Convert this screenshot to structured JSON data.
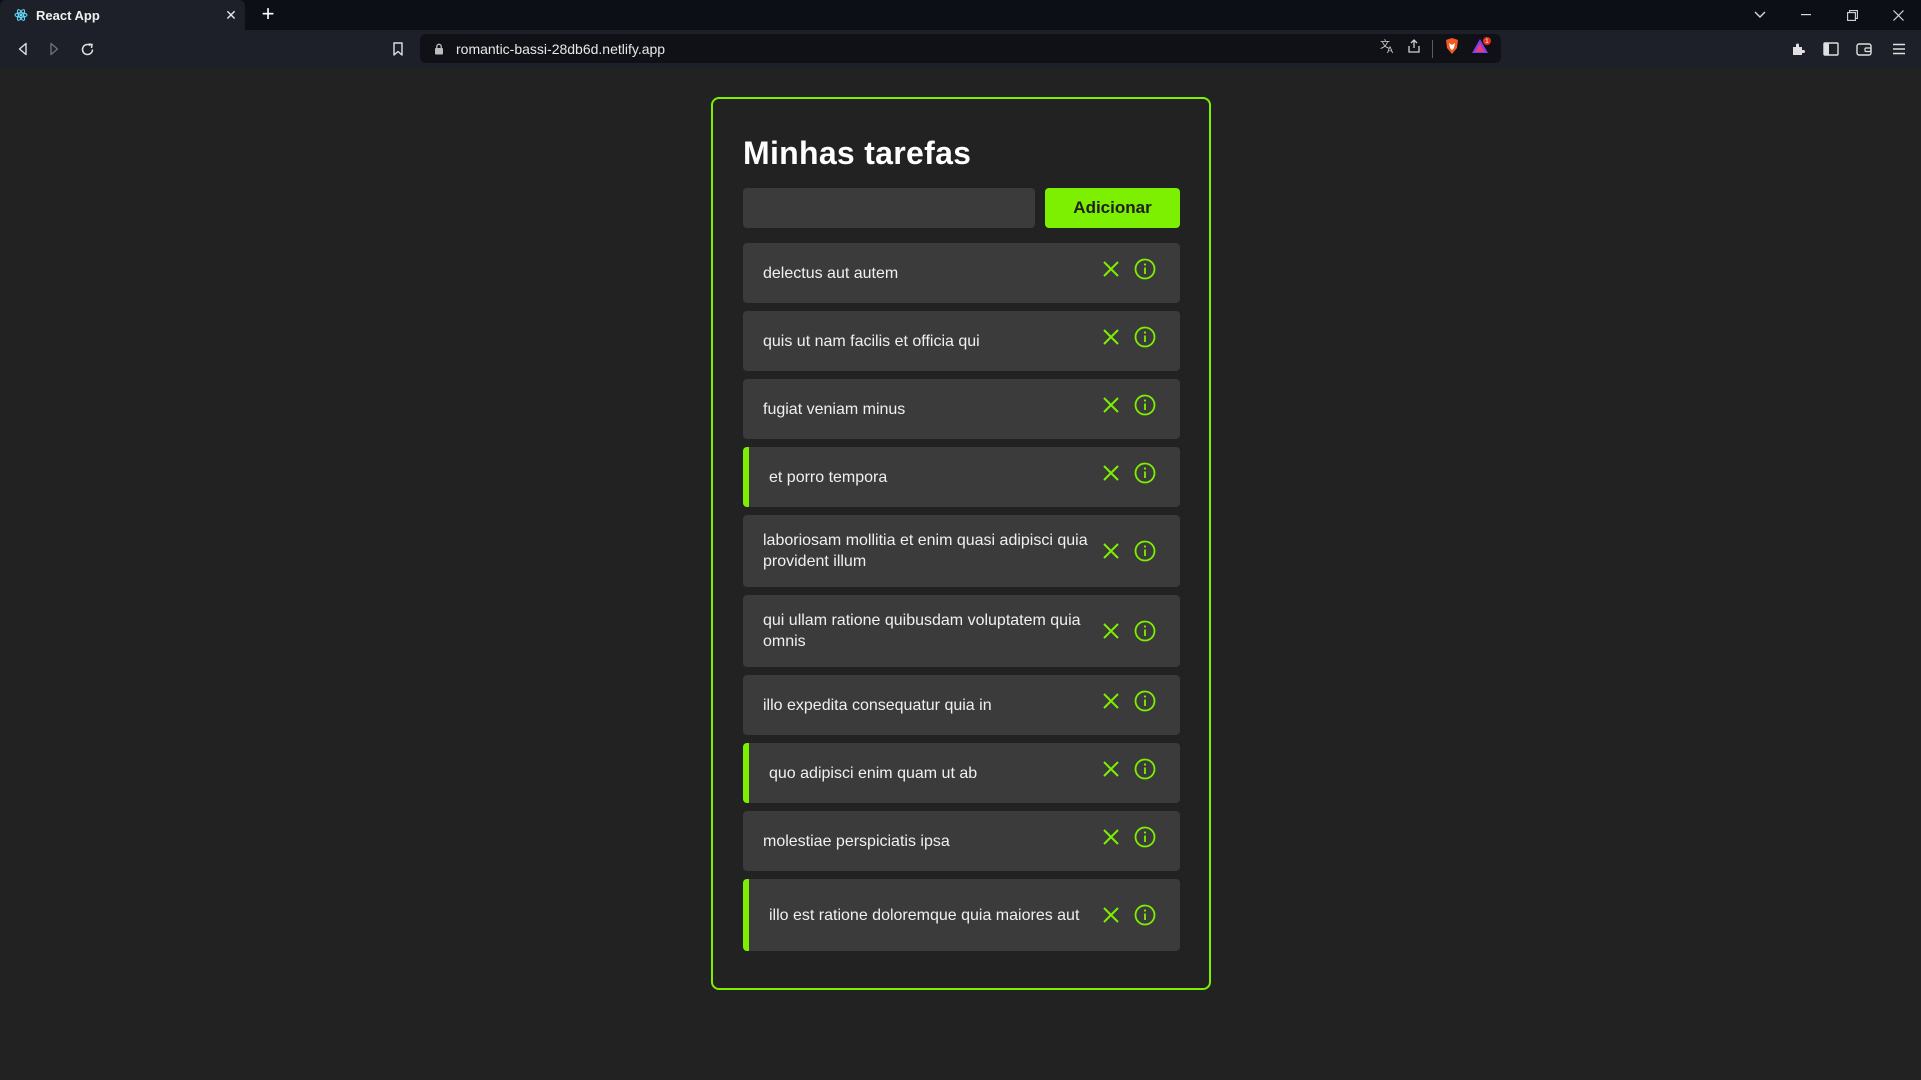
{
  "browser": {
    "tab_title": "React App",
    "url": "romantic-bassi-28db6d.netlify.app",
    "new_tab_symbol": "+",
    "tab_close_symbol": "✕",
    "notification_count": "1"
  },
  "app": {
    "title": "Minhas tarefas",
    "input_value": "",
    "input_placeholder": "",
    "add_button_label": "Adicionar",
    "accent_color": "#7cf000"
  },
  "tasks": [
    {
      "title": "delectus aut autem",
      "completed": false
    },
    {
      "title": "quis ut nam facilis et officia qui",
      "completed": false
    },
    {
      "title": "fugiat veniam minus",
      "completed": false
    },
    {
      "title": "et porro tempora",
      "completed": true
    },
    {
      "title": "laboriosam mollitia et enim quasi adipisci quia provident illum",
      "completed": false
    },
    {
      "title": "qui ullam ratione quibusdam voluptatem quia omnis",
      "completed": false
    },
    {
      "title": "illo expedita consequatur quia in",
      "completed": false
    },
    {
      "title": "quo adipisci enim quam ut ab",
      "completed": true
    },
    {
      "title": "molestiae perspiciatis ipsa",
      "completed": false
    },
    {
      "title": "illo est ratione doloremque quia maiores aut",
      "completed": true
    }
  ]
}
